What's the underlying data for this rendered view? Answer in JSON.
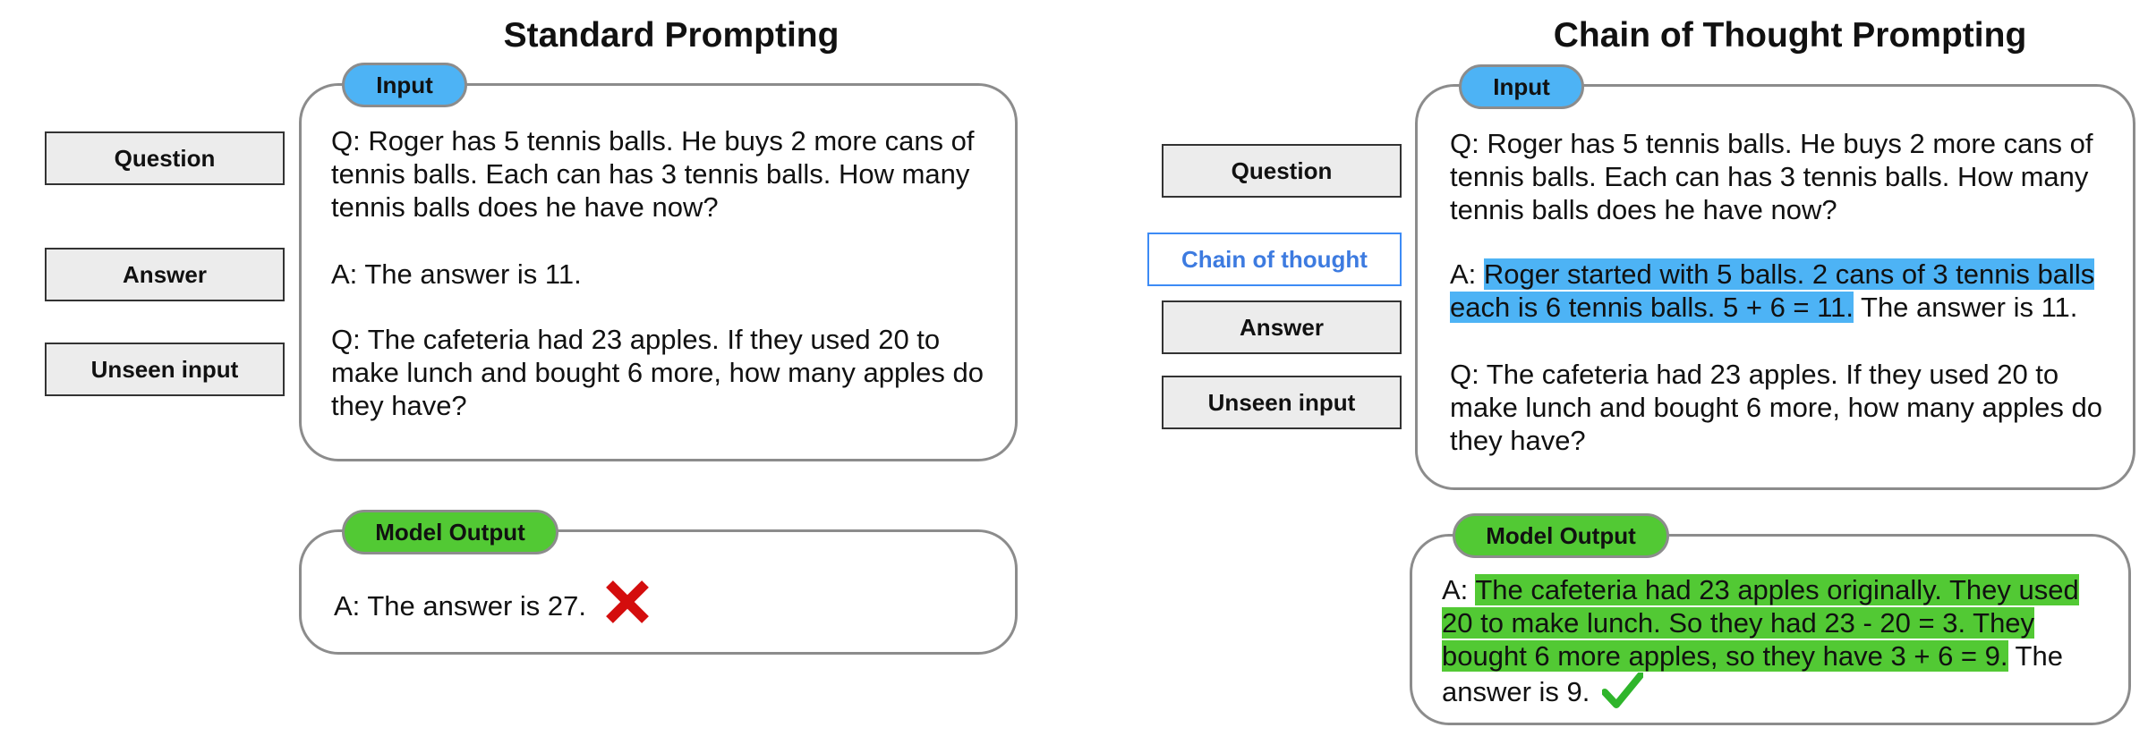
{
  "standard": {
    "title": "Standard Prompting",
    "input_tag": "Input",
    "output_tag": "Model Output",
    "labels": {
      "question": "Question",
      "answer": "Answer",
      "unseen": "Unseen input"
    },
    "q1": "Q: Roger has 5 tennis balls. He buys 2 more cans of tennis balls. Each can has 3 tennis balls. How many tennis balls does he have now?",
    "a1": "A: The answer is 11.",
    "q2": "Q: The cafeteria had 23 apples. If they used 20 to make lunch and bought 6 more, how many apples do they have?",
    "output": "A: The answer is 27.",
    "output_mark": "cross-mark-icon"
  },
  "cot": {
    "title": "Chain of Thought Prompting",
    "input_tag": "Input",
    "output_tag": "Model Output",
    "labels": {
      "question": "Question",
      "chain": "Chain of thought",
      "answer": "Answer",
      "unseen": "Unseen input"
    },
    "q1": "Q: Roger has 5 tennis balls. He buys 2 more cans of tennis balls. Each can has 3 tennis balls. How many tennis balls does he have now?",
    "a1_prefix": "A: ",
    "a1_reasoning": "Roger started with 5 balls. 2 cans of 3 tennis balls each is 6 tennis balls. 5 + 6 = 11.",
    "a1_answer": " The answer is 11.",
    "q2": "Q: The cafeteria had 23 apples. If they used 20 to make lunch and bought 6 more, how many apples do they have?",
    "output_prefix": "A: ",
    "output_reasoning": "The cafeteria had 23 apples originally. They used 20 to make lunch. So they had 23 - 20 = 3. They bought 6 more apples, so they have 3 + 6 = 9.",
    "output_answer": " The answer is 9.",
    "output_mark": "check-mark-icon"
  },
  "colors": {
    "input_accent": "#4db3f5",
    "output_accent": "#52c934",
    "cross": "#d40d0d",
    "check": "#2fb52b",
    "chain_label": "#3d8bf5"
  }
}
